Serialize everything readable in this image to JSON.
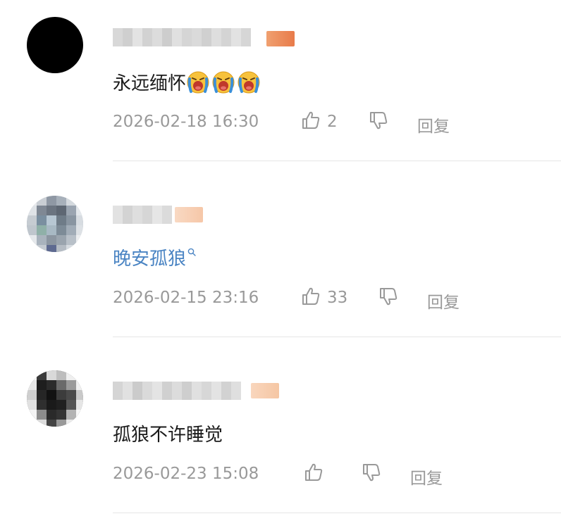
{
  "comments": [
    {
      "text": "永远缅怀",
      "emoji": "crying-face-icon",
      "emoji_count": 3,
      "timestamp": "2026-02-18 16:30",
      "likes": "2",
      "reply_label": "回复"
    },
    {
      "text": "晚安孤狼",
      "timestamp": "2026-02-15 23:16",
      "likes": "33",
      "reply_label": "回复"
    },
    {
      "text": "孤狼不许睡觉",
      "timestamp": "2026-02-23 15:08",
      "likes": "",
      "reply_label": "回复"
    }
  ],
  "colors": {
    "text": "#1a1a1a",
    "link": "#4a84c3",
    "meta": "#999999",
    "divider": "#e6e6e6"
  }
}
